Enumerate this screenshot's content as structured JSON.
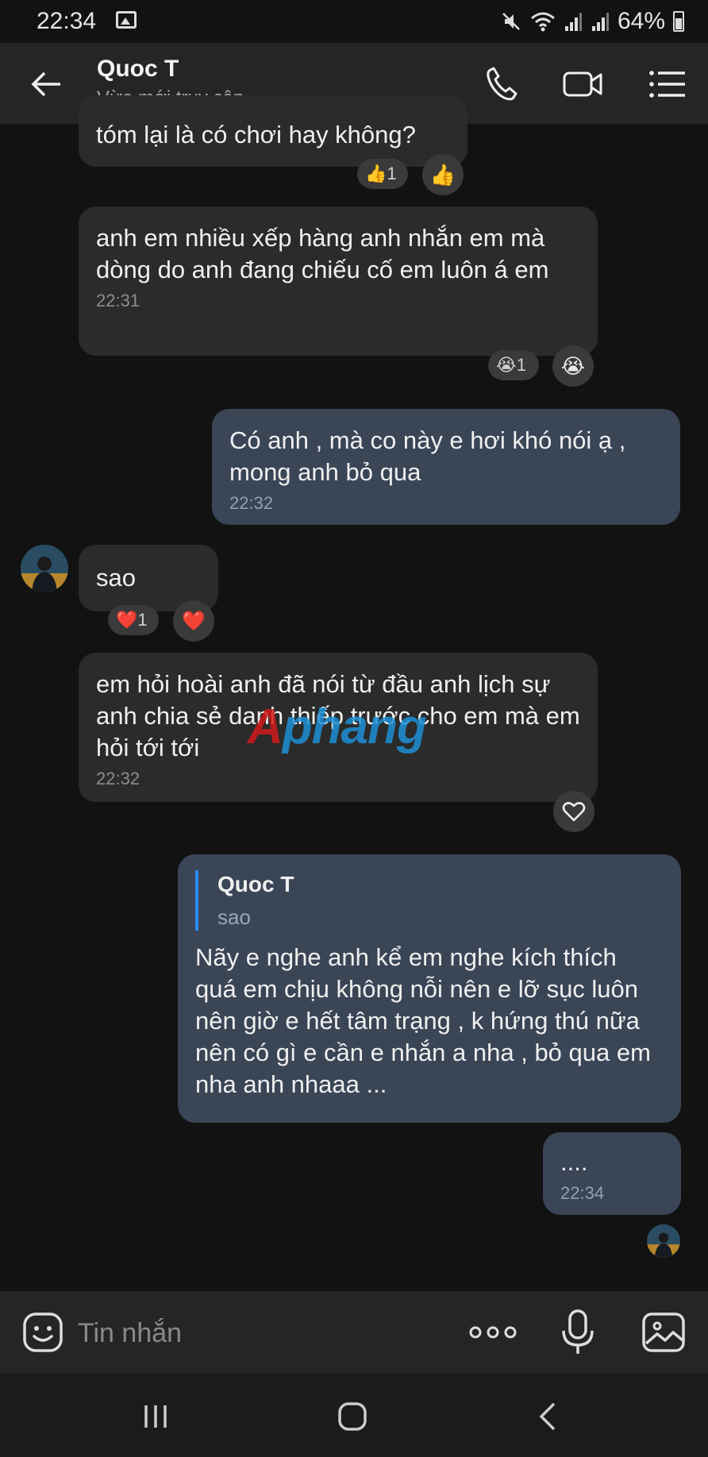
{
  "status_bar": {
    "time": "22:34",
    "battery": "64%"
  },
  "header": {
    "contact_name": "Quoc T",
    "contact_status": "Vừa mới truy cập"
  },
  "messages": [
    {
      "direction": "in",
      "text": "tóm lại là có chơi hay không?",
      "reaction": {
        "emoji": "👍",
        "count": "1"
      }
    },
    {
      "direction": "in",
      "text": "anh em nhiều xếp hàng anh nhắn em mà dòng do anh đang chiếu cố em luôn á em",
      "time": "22:31",
      "reaction": {
        "emoji": "😭",
        "count": "1"
      }
    },
    {
      "direction": "out",
      "text": "Có anh , mà co này e hơi khó nói ạ , mong anh bỏ qua",
      "time": "22:32"
    },
    {
      "direction": "in",
      "text": "sao",
      "reaction": {
        "emoji": "❤️",
        "count": "1"
      }
    },
    {
      "direction": "in",
      "text": "em hỏi hoài anh đã nói từ đầu anh lịch sự anh chia sẻ danh thiếp trước cho em mà em hỏi tới tới",
      "time": "22:32"
    },
    {
      "direction": "out",
      "quote": {
        "name": "Quoc T",
        "text": "sao"
      },
      "text": "Nãy e nghe anh kể em nghe kích thích quá em chịu không nỗi nên e lỡ sục luôn nên giờ e hết tâm trạng , k hứng thú nữa nên có gì e cần e nhắn a nha , bỏ qua em nha anh nhaaa ..."
    },
    {
      "direction": "out",
      "text": "....",
      "time": "22:34"
    }
  ],
  "watermark": {
    "part1": "A",
    "part2": "phang"
  },
  "composer": {
    "placeholder": "Tin nhắn"
  },
  "icons": {
    "back": "arrow-left-icon",
    "call": "phone-icon",
    "video": "video-camera-icon",
    "menu": "list-menu-icon",
    "emoji": "emoji-icon",
    "more": "more-dots-icon",
    "mic": "microphone-icon",
    "image": "image-icon"
  },
  "colors": {
    "background": "#121212",
    "header": "#252525",
    "incoming_bubble": "#2b2b2b",
    "outgoing_bubble": "#3a4556",
    "quote_bar": "#2b8cf2"
  }
}
